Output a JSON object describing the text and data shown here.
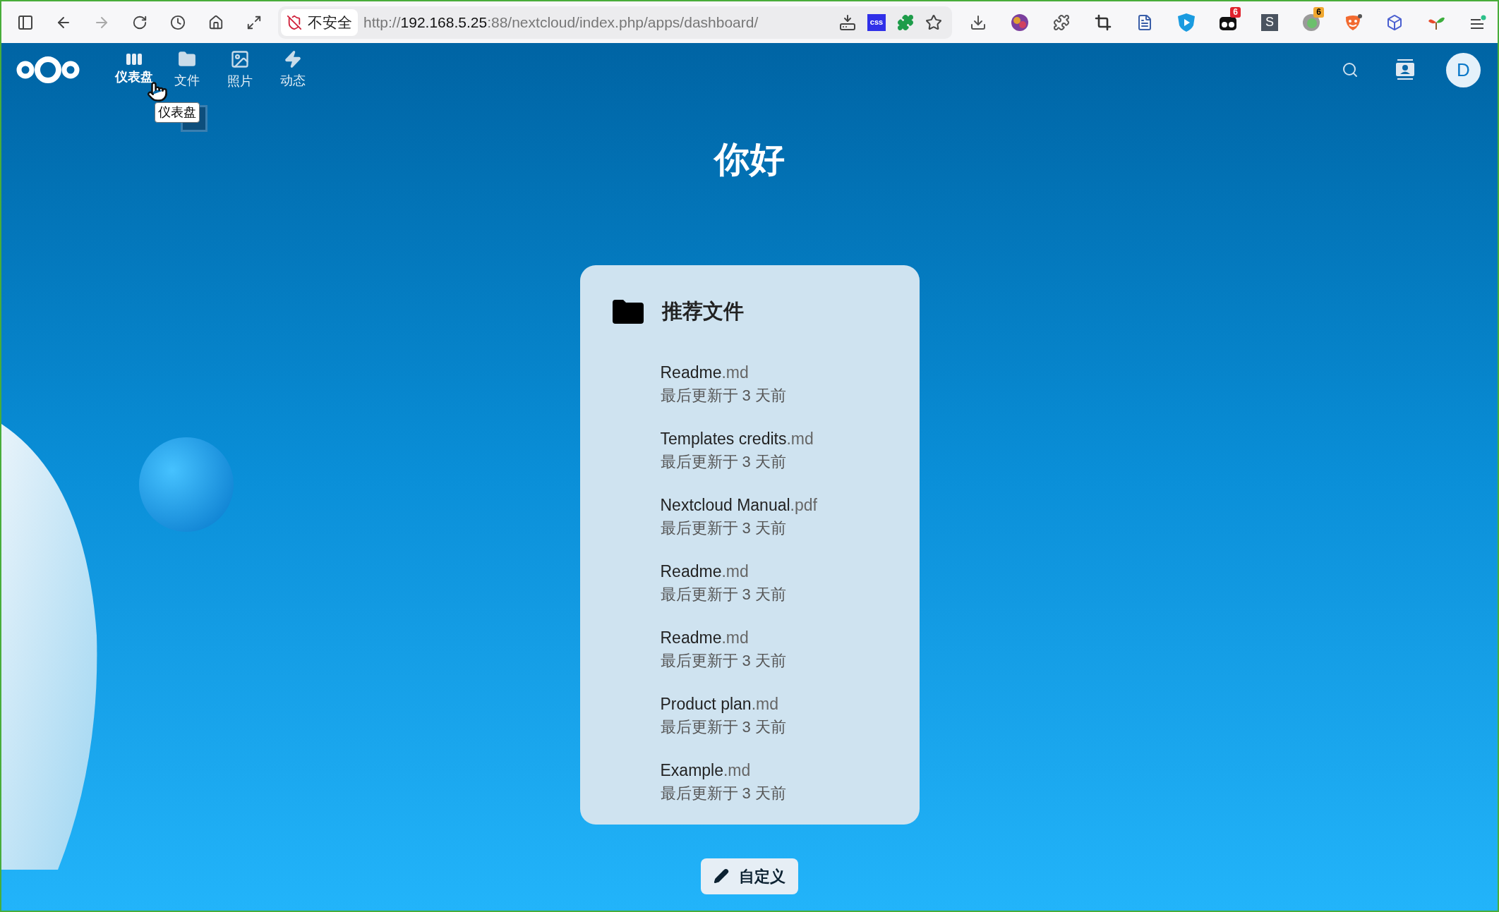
{
  "browser": {
    "security_label": "不安全",
    "url": {
      "scheme": "http://",
      "host": "192.168.5.25",
      "path": ":88/nextcloud/index.php/apps/dashboard/"
    },
    "extensions": [
      {
        "kind": "download"
      },
      {
        "kind": "colorball"
      },
      {
        "kind": "puzzle"
      },
      {
        "kind": "crop"
      },
      {
        "kind": "document"
      },
      {
        "kind": "shield"
      },
      {
        "kind": "eyes",
        "badge": "6"
      },
      {
        "kind": "letter",
        "label": "S"
      },
      {
        "kind": "circle",
        "badge": "6"
      },
      {
        "kind": "mask"
      },
      {
        "kind": "cube"
      },
      {
        "kind": "leaf"
      },
      {
        "kind": "menu"
      }
    ],
    "address_actions": [
      {
        "kind": "install"
      },
      {
        "kind": "css",
        "label": "css"
      },
      {
        "kind": "extension"
      },
      {
        "kind": "star"
      }
    ]
  },
  "nav": [
    {
      "label": "仪表盘",
      "kind": "dashboard",
      "selected": true
    },
    {
      "label": "文件",
      "kind": "files",
      "selected": false
    },
    {
      "label": "照片",
      "kind": "photos",
      "selected": false
    },
    {
      "label": "动态",
      "kind": "activity",
      "selected": false
    }
  ],
  "tooltip": "仪表盘",
  "avatar": "D",
  "greeting": "你好",
  "widget": {
    "title": "推荐文件",
    "files": [
      {
        "name": "Readme",
        "ext": ".md",
        "modified": "最后更新于 3 天前"
      },
      {
        "name": "Templates credits",
        "ext": ".md",
        "modified": "最后更新于 3 天前"
      },
      {
        "name": "Nextcloud Manual",
        "ext": ".pdf",
        "modified": "最后更新于 3 天前"
      },
      {
        "name": "Readme",
        "ext": ".md",
        "modified": "最后更新于 3 天前"
      },
      {
        "name": "Readme",
        "ext": ".md",
        "modified": "最后更新于 3 天前"
      },
      {
        "name": "Product plan",
        "ext": ".md",
        "modified": "最后更新于 3 天前"
      },
      {
        "name": "Example",
        "ext": ".md",
        "modified": "最后更新于 3 天前"
      }
    ]
  },
  "customize_button": "自定义"
}
